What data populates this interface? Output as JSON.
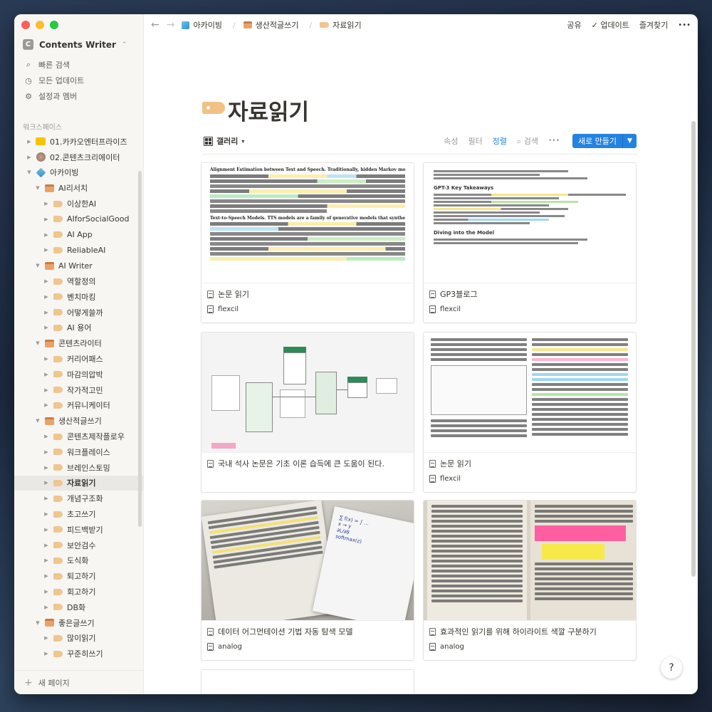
{
  "sidebar": {
    "workspace_initial": "C",
    "workspace_name": "Contents Writer",
    "menu": [
      {
        "label": "빠른 검색"
      },
      {
        "label": "모든 업데이트"
      },
      {
        "label": "설정과 멤버"
      }
    ],
    "section_label": "워크스페이스",
    "tree": [
      {
        "label": "01.카카오엔터프라이즈",
        "icon": "ico1"
      },
      {
        "label": "02.콘텐츠크리에이터",
        "icon": "ico2"
      },
      {
        "label": "아카이빙",
        "icon": "ico3"
      },
      {
        "label": "AI리서치",
        "icon": "folder"
      },
      {
        "label": "이상한AI",
        "icon": "tag"
      },
      {
        "label": "AIforSocialGood",
        "icon": "tag"
      },
      {
        "label": "AI App",
        "icon": "tag"
      },
      {
        "label": "ReliableAI",
        "icon": "tag"
      },
      {
        "label": "AI Writer",
        "icon": "folder"
      },
      {
        "label": "역할정의",
        "icon": "tag"
      },
      {
        "label": "벤치마킹",
        "icon": "tag"
      },
      {
        "label": "어떻게쓸까",
        "icon": "tag"
      },
      {
        "label": "AI 용어",
        "icon": "tag"
      },
      {
        "label": "콘텐츠라이터",
        "icon": "folder"
      },
      {
        "label": "커리어패스",
        "icon": "tag"
      },
      {
        "label": "마감의압박",
        "icon": "tag"
      },
      {
        "label": "작가적고민",
        "icon": "tag"
      },
      {
        "label": "커뮤니케이터",
        "icon": "tag"
      },
      {
        "label": "생산적글쓰기",
        "icon": "folder"
      },
      {
        "label": "콘텐츠제작플로우",
        "icon": "tag"
      },
      {
        "label": "워크플레이스",
        "icon": "tag"
      },
      {
        "label": "브레인스토밍",
        "icon": "tag"
      },
      {
        "label": "자료읽기",
        "icon": "tag"
      },
      {
        "label": "개념구조화",
        "icon": "tag"
      },
      {
        "label": "초고쓰기",
        "icon": "tag"
      },
      {
        "label": "피드백받기",
        "icon": "tag"
      },
      {
        "label": "보안검수",
        "icon": "tag"
      },
      {
        "label": "도식화",
        "icon": "tag"
      },
      {
        "label": "퇴고하기",
        "icon": "tag"
      },
      {
        "label": "회고하기",
        "icon": "tag"
      },
      {
        "label": "DB화",
        "icon": "tag"
      },
      {
        "label": "좋은글쓰기",
        "icon": "folder"
      },
      {
        "label": "많이읽기",
        "icon": "tag"
      },
      {
        "label": "꾸준히쓰기",
        "icon": "tag"
      }
    ],
    "new_page": "새 페이지"
  },
  "topbar": {
    "crumbs": [
      "아카이빙",
      "생산적글쓰기",
      "자료읽기"
    ],
    "share": "공유",
    "updates": "업데이트",
    "favorites": "즐겨찾기",
    "more": "•••"
  },
  "page": {
    "title": "자료읽기",
    "view_name": "갤러리",
    "properties": "속성",
    "filter": "필터",
    "sort": "정렬",
    "search": "검색",
    "more": "•••",
    "new_button": "새로 만들기"
  },
  "cards": [
    {
      "title": "논문 읽기",
      "prop": "flexcil"
    },
    {
      "title": "GP3블로그",
      "prop": "flexcil"
    },
    {
      "title": "국내 석사 논문은 기초 이론 습득에 큰 도움이 된다.",
      "prop": ""
    },
    {
      "title": "논문 읽기",
      "prop": "flexcil"
    },
    {
      "title": "데이터 어그먼테이션 기법 자동 탐색 모델",
      "prop": "analog"
    },
    {
      "title": "효과적인 읽기를 위해 하이라이트 색깔 구분하기",
      "prop": "analog"
    }
  ],
  "thumbs": {
    "card0_text": [
      "Alignment Estimation between Text and Speech. Traditionally, hidden Markov models (HMMs)",
      "Text-to-Speech Models. TTS models are a family of generative models that synthesize speech from"
    ],
    "card1_text": [
      "GPT-3 Key Takeaways",
      "Diving into the Model"
    ]
  },
  "colors": {
    "accent": "#2383e2",
    "sidebar_bg": "#f7f6f3",
    "text": "#37352f"
  }
}
